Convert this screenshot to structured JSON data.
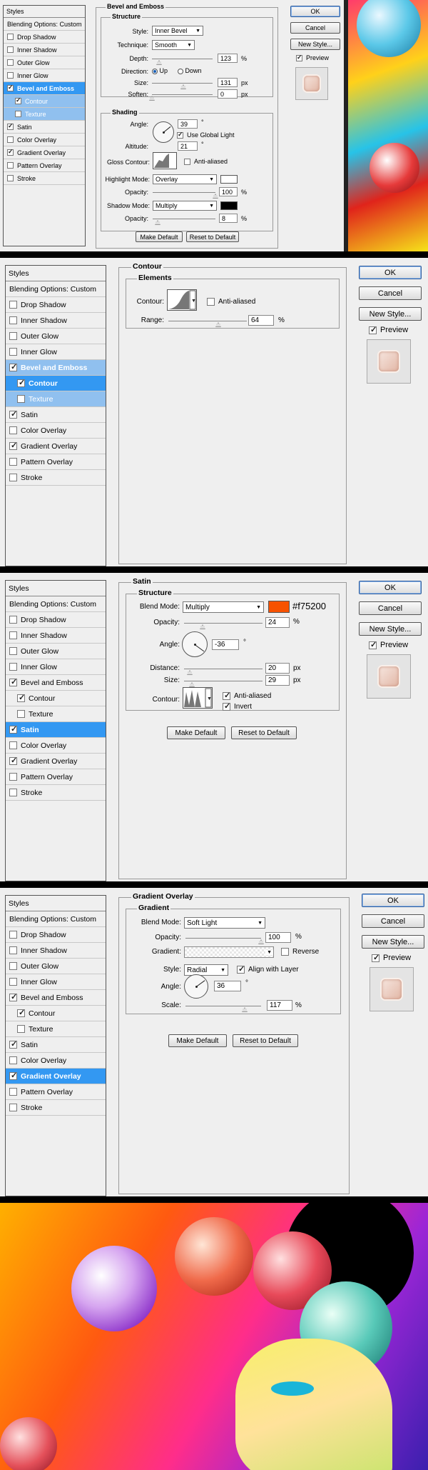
{
  "styles_list": {
    "header": "Styles",
    "blending": "Blending Options: Custom",
    "items": [
      "Drop Shadow",
      "Inner Shadow",
      "Outer Glow",
      "Inner Glow",
      "Bevel and Emboss",
      "Contour",
      "Texture",
      "Satin",
      "Color Overlay",
      "Gradient Overlay",
      "Pattern Overlay",
      "Stroke"
    ]
  },
  "buttons": {
    "ok": "OK",
    "cancel": "Cancel",
    "new_style": "New Style...",
    "preview": "Preview",
    "make_default": "Make Default",
    "reset_default": "Reset to Default"
  },
  "bevel": {
    "title": "Bevel and Emboss",
    "structure": "Structure",
    "style_label": "Style:",
    "style_value": "Inner Bevel",
    "technique_label": "Technique:",
    "technique_value": "Smooth",
    "depth_label": "Depth:",
    "depth_value": "123",
    "depth_unit": "%",
    "depth_fraction": 0.12,
    "direction_label": "Direction:",
    "up": "Up",
    "down": "Down",
    "size_label": "Size:",
    "size_value": "131",
    "size_unit": "px",
    "size_fraction": 0.52,
    "soften_label": "Soften:",
    "soften_value": "0",
    "soften_unit": "px",
    "soften_fraction": 0.0,
    "shading": "Shading",
    "angle_label": "Angle:",
    "angle_value": "39",
    "angle_unit": "°",
    "global_light": "Use Global Light",
    "altitude_label": "Altitude:",
    "altitude_value": "21",
    "altitude_unit": "°",
    "gloss_label": "Gloss Contour:",
    "anti_aliased": "Anti-aliased",
    "highlight_label": "Highlight Mode:",
    "highlight_value": "Overlay",
    "highlight_color": "#ffffff",
    "opacity_label": "Opacity:",
    "hl_opacity": "100",
    "hl_opacity_fraction": 1.0,
    "shadow_label": "Shadow Mode:",
    "shadow_value": "Multiply",
    "shadow_color": "#000000",
    "sh_opacity": "8",
    "sh_opacity_fraction": 0.08,
    "percent": "%"
  },
  "contour": {
    "title": "Contour",
    "elements": "Elements",
    "contour_label": "Contour:",
    "anti_aliased": "Anti-aliased",
    "range_label": "Range:",
    "range_value": "64",
    "range_unit": "%",
    "range_fraction": 0.64
  },
  "satin": {
    "title": "Satin",
    "structure": "Structure",
    "blend_label": "Blend Mode:",
    "blend_value": "Multiply",
    "color": "#f75200",
    "color_text": "#f75200",
    "opacity_label": "Opacity:",
    "opacity_value": "24",
    "opacity_fraction": 0.24,
    "angle_label": "Angle:",
    "angle_value": "-36",
    "angle_unit": "°",
    "distance_label": "Distance:",
    "distance_value": "20",
    "distance_fraction": 0.07,
    "size_label": "Size:",
    "size_value": "29",
    "size_fraction": 0.1,
    "contour_label": "Contour:",
    "anti_aliased": "Anti-aliased",
    "invert": "Invert",
    "px": "px",
    "percent": "%"
  },
  "gradient": {
    "title": "Gradient Overlay",
    "section": "Gradient",
    "blend_label": "Blend Mode:",
    "blend_value": "Soft Light",
    "opacity_label": "Opacity:",
    "opacity_value": "100",
    "opacity_fraction": 1.0,
    "gradient_label": "Gradient:",
    "reverse": "Reverse",
    "style_label": "Style:",
    "style_value": "Radial",
    "align": "Align with Layer",
    "angle_label": "Angle:",
    "angle_value": "36",
    "angle_unit": "°",
    "scale_label": "Scale:",
    "scale_value": "117",
    "scale_fraction": 0.78,
    "percent": "%"
  }
}
